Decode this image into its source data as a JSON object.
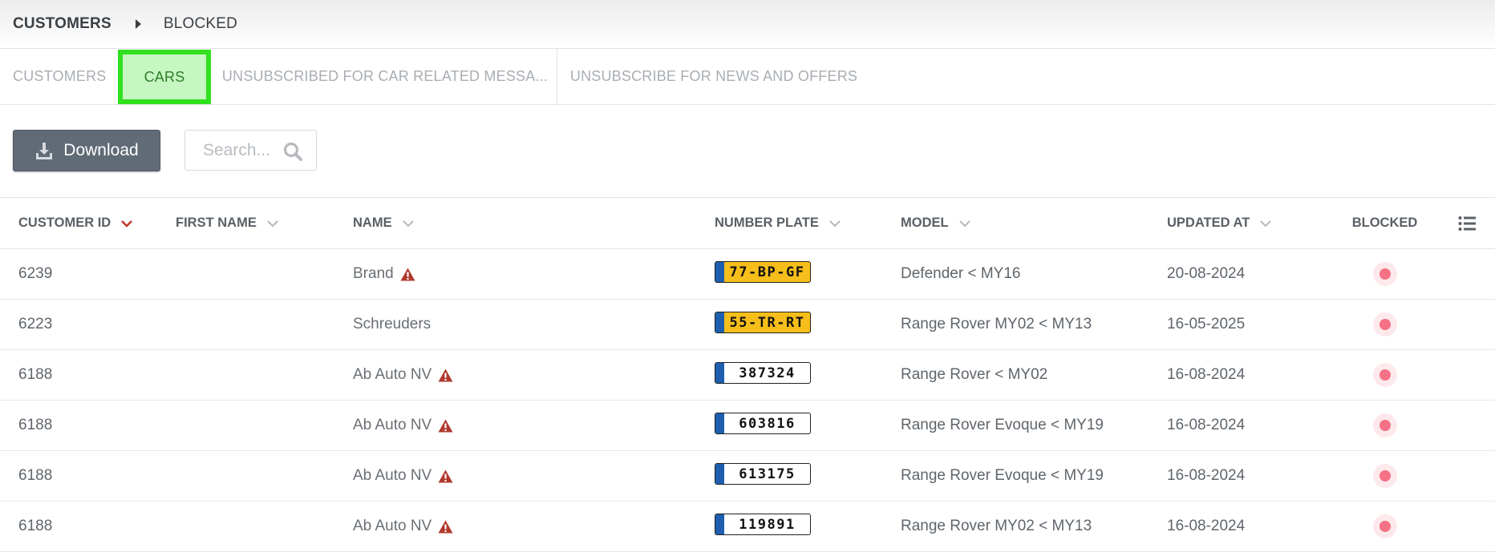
{
  "breadcrumb": {
    "root": "CUSTOMERS",
    "current": "BLOCKED"
  },
  "tabs": [
    {
      "label": "CUSTOMERS",
      "active": false
    },
    {
      "label": "CARS",
      "active": true
    },
    {
      "label": "UNSUBSCRIBED FOR CAR RELATED MESSA...",
      "active": false
    },
    {
      "label": "UNSUBSCRIBE FOR NEWS AND OFFERS",
      "active": false
    }
  ],
  "toolbar": {
    "download_label": "Download",
    "search_placeholder": "Search..."
  },
  "table": {
    "columns": [
      "CUSTOMER ID",
      "FIRST NAME",
      "NAME",
      "NUMBER PLATE",
      "MODEL",
      "UPDATED AT",
      "BLOCKED"
    ],
    "sorted_column": "CUSTOMER ID",
    "rows": [
      {
        "customer_id": "6239",
        "first_name": "",
        "name": "Brand",
        "warning": true,
        "plate": "77-BP-GF",
        "plate_style": "yellow",
        "model": "Defender < MY16",
        "updated_at": "20-08-2024",
        "blocked": true
      },
      {
        "customer_id": "6223",
        "first_name": "",
        "name": "Schreuders",
        "warning": false,
        "plate": "55-TR-RT",
        "plate_style": "yellow",
        "model": "Range Rover MY02 < MY13",
        "updated_at": "16-05-2025",
        "blocked": true
      },
      {
        "customer_id": "6188",
        "first_name": "",
        "name": "Ab Auto NV",
        "warning": true,
        "plate": "387324",
        "plate_style": "white",
        "model": "Range Rover < MY02",
        "updated_at": "16-08-2024",
        "blocked": true
      },
      {
        "customer_id": "6188",
        "first_name": "",
        "name": "Ab Auto NV",
        "warning": true,
        "plate": "603816",
        "plate_style": "white",
        "model": "Range Rover Evoque < MY19",
        "updated_at": "16-08-2024",
        "blocked": true
      },
      {
        "customer_id": "6188",
        "first_name": "",
        "name": "Ab Auto NV",
        "warning": true,
        "plate": "613175",
        "plate_style": "white",
        "model": "Range Rover Evoque < MY19",
        "updated_at": "16-08-2024",
        "blocked": true
      },
      {
        "customer_id": "6188",
        "first_name": "",
        "name": "Ab Auto NV",
        "warning": true,
        "plate": "119891",
        "plate_style": "white",
        "model": "Range Rover MY02 < MY13",
        "updated_at": "16-08-2024",
        "blocked": true
      }
    ]
  },
  "colors": {
    "active_tab_bg": "#c6f6c1",
    "active_tab_border": "#31e01e",
    "sort_chevron": "#c0392b",
    "warning": "#b03a2e",
    "plate_yellow": "#f5be1a",
    "plate_white": "#ffffff",
    "blocked_dot": "#f47186"
  },
  "icons": {
    "download": "download-icon",
    "search": "search-icon",
    "sort": "chevron-down-icon",
    "warning": "warning-icon",
    "column_settings": "list-icon"
  }
}
